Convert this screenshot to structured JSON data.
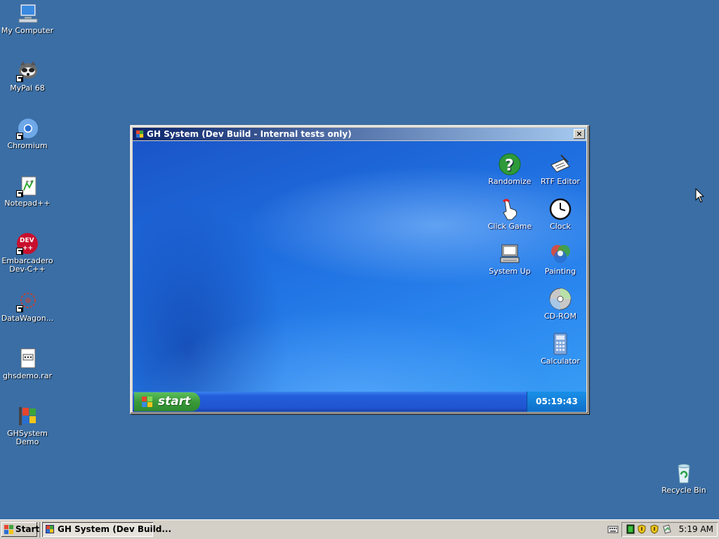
{
  "desktop": {
    "icons": [
      {
        "label": "My Computer"
      },
      {
        "label": "MyPal 68"
      },
      {
        "label": "Chromium"
      },
      {
        "label": "Notepad++"
      },
      {
        "label": "Embarcadero Dev-C++"
      },
      {
        "label": "DataWagon..."
      },
      {
        "label": "ghsdemo.rar"
      },
      {
        "label": "GHSystem Demo"
      },
      {
        "label": "Recycle Bin"
      }
    ]
  },
  "window": {
    "title": "GH System (Dev Build - Internal tests only)",
    "close_label": "×",
    "apps": [
      {
        "label": "Randomize",
        "icon": "question-icon"
      },
      {
        "label": "RTF Editor",
        "icon": "notepad-pen-icon"
      },
      {
        "label": "Click Game",
        "icon": "hand-pointer-icon"
      },
      {
        "label": "Clock",
        "icon": "clock-icon"
      },
      {
        "label": "System Up",
        "icon": "computer-icon"
      },
      {
        "label": "Painting",
        "icon": "color-circles-icon"
      },
      {
        "label": "CD-ROM",
        "icon": "cd-icon"
      },
      {
        "label": "Calculator",
        "icon": "calculator-icon"
      }
    ],
    "taskbar": {
      "start_label": "start",
      "clock": "05:19:43 AM"
    }
  },
  "taskbar": {
    "start_label": "Start",
    "task_label": "GH System (Dev Build...",
    "time": "5:19 AM"
  }
}
